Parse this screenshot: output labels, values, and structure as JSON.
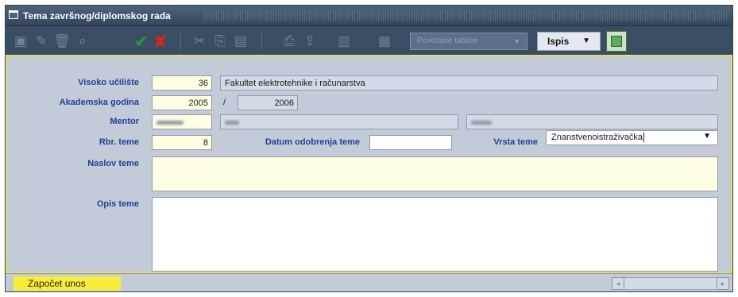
{
  "window": {
    "title": "Tema završnog/diplomskog rada"
  },
  "toolbar": {
    "buttons": [
      {
        "icon": "new-record-icon",
        "glyph": "▣"
      },
      {
        "icon": "edit-record-icon",
        "glyph": "✎"
      },
      {
        "icon": "delete-record-icon",
        "glyph": "🗑"
      },
      {
        "icon": "find-icon",
        "glyph": "⌕"
      },
      {
        "icon": "confirm-icon",
        "glyph": "✔"
      },
      {
        "icon": "cancel-icon",
        "glyph": "✘"
      },
      {
        "icon": "cut-icon",
        "glyph": "✂"
      },
      {
        "icon": "copy-icon",
        "glyph": "⎘"
      },
      {
        "icon": "paste-icon",
        "glyph": "▤"
      },
      {
        "icon": "print-icon",
        "glyph": "⎙"
      },
      {
        "icon": "export-icon",
        "glyph": "⇪"
      },
      {
        "icon": "columns-icon",
        "glyph": "▥"
      },
      {
        "icon": "grid-icon",
        "glyph": "▦"
      }
    ],
    "tables_combo": "Povezane tablice",
    "print_label": "Ispis",
    "spreadsheet_icon": "spreadsheet-icon"
  },
  "form": {
    "institution": {
      "label": "Visoko učilište",
      "code": "36",
      "name": "Fakultet elektrotehnike i računarstva"
    },
    "academic_year": {
      "label": "Akademska godina",
      "from": "2005",
      "separator": "/",
      "to": "2006"
    },
    "mentor": {
      "label": "Mentor"
    },
    "topic_no": {
      "label": "Rbr. teme",
      "value": "8"
    },
    "approval_date": {
      "label": "Datum odobrenja teme",
      "value": ""
    },
    "topic_type": {
      "label": "Vrsta teme",
      "value": "Znanstvenoistraživačka"
    },
    "topic_title": {
      "label": "Naslov teme",
      "value": ""
    },
    "topic_description": {
      "label": "Opis teme",
      "value": ""
    }
  },
  "status": {
    "message": "Započet unos"
  },
  "colors": {
    "toolbar_bg": "#3a4d63",
    "form_bg": "#c3cbd8",
    "label_text": "#243f95",
    "highlight_border": "#e7dc6a",
    "status_message_bg": "#f8ec3c"
  }
}
